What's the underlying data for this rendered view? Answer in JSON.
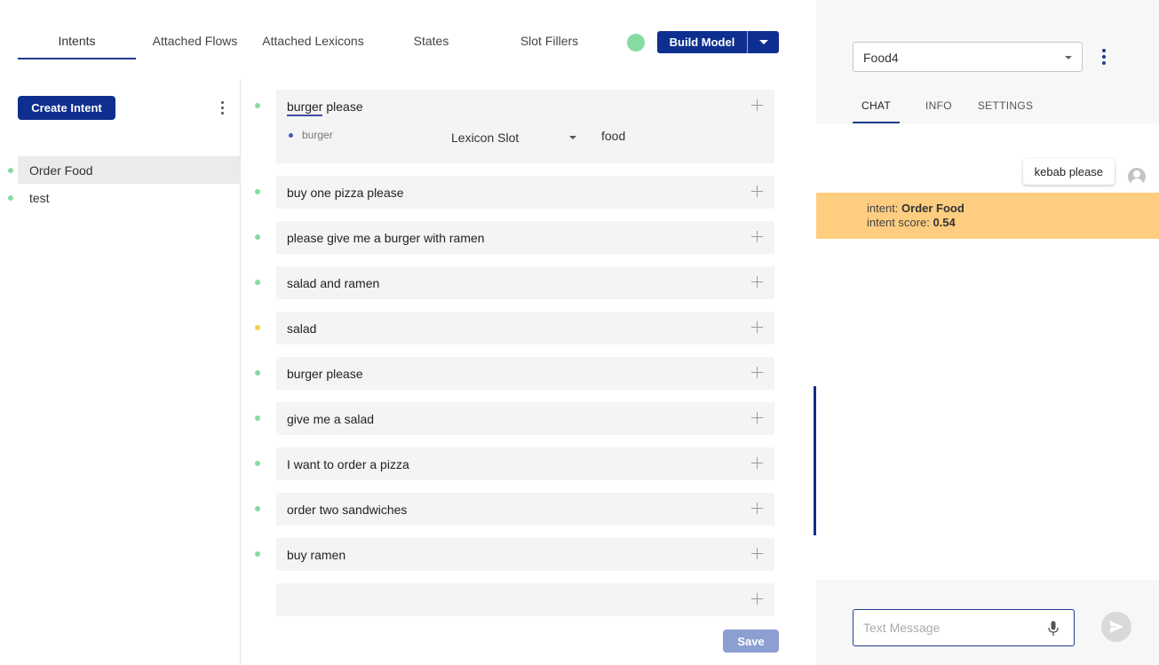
{
  "tabs": [
    {
      "label": "Intents",
      "active": true
    },
    {
      "label": "Attached Flows",
      "active": false
    },
    {
      "label": "Attached Lexicons",
      "active": false
    },
    {
      "label": "States",
      "active": false
    },
    {
      "label": "Slot Fillers",
      "active": false
    }
  ],
  "toolbar": {
    "build_label": "Build Model",
    "status_color": "#86dba3"
  },
  "left": {
    "create_label": "Create Intent",
    "intents": [
      {
        "label": "Order Food",
        "selected": true
      },
      {
        "label": "test",
        "selected": false
      }
    ]
  },
  "utterances": {
    "first": {
      "word": "burger",
      "rest": " please",
      "slot_word": "burger",
      "slot_type": "Lexicon Slot",
      "slot_value": "food"
    },
    "items": [
      {
        "text": "buy one pizza please",
        "status": "green"
      },
      {
        "text": "please give me a burger with ramen",
        "status": "green"
      },
      {
        "text": "salad and ramen",
        "status": "green"
      },
      {
        "text": "salad",
        "status": "yellow"
      },
      {
        "text": "burger please",
        "status": "green"
      },
      {
        "text": "give me a salad",
        "status": "green"
      },
      {
        "text": "I want to order a pizza",
        "status": "green"
      },
      {
        "text": "order two sandwiches",
        "status": "green"
      },
      {
        "text": "buy ramen",
        "status": "green"
      }
    ],
    "save_label": "Save"
  },
  "right": {
    "bot_select": "Food4",
    "tabs": [
      {
        "label": "CHAT",
        "active": true
      },
      {
        "label": "INFO",
        "active": false
      },
      {
        "label": "SETTINGS",
        "active": false
      }
    ],
    "message": "kebab please",
    "intent_label": "intent: ",
    "intent_value": "Order Food",
    "score_label": "intent score: ",
    "score_value": "0.54",
    "input_placeholder": "Text Message"
  }
}
